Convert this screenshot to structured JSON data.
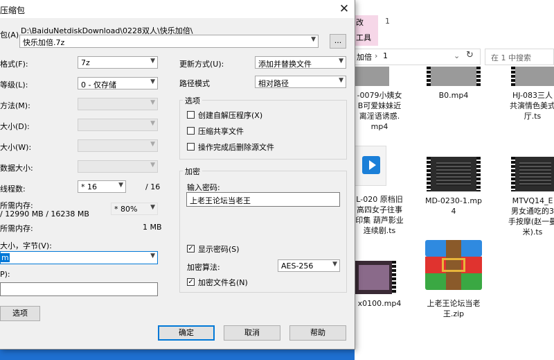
{
  "dialog": {
    "title": "压缩包",
    "close_glyph": "✕",
    "archive_label": "包(A)",
    "archive_path": "D:\\BaiduNetdiskDownload\\0228双人\\快乐加倍\\",
    "archive_name": "快乐加倍.7z",
    "browse_label": "...",
    "format": {
      "label": "格式(F):",
      "value": "7z"
    },
    "level": {
      "label": "等级(L):",
      "value": "0 - 仅存储"
    },
    "method": {
      "label": "方法(M):"
    },
    "dict": {
      "label": "大小(D):"
    },
    "word": {
      "label": "大小(W):"
    },
    "solid": {
      "label": "数据大小:"
    },
    "threads": {
      "label": "线程数:",
      "value": "* 16",
      "max": "/ 16"
    },
    "mem_compress": {
      "label": "所需内存:",
      "detail": "/ 12990 MB / 16238 MB",
      "value": "* 80%"
    },
    "mem_decompress": {
      "label": "所需内存:",
      "value": "1 MB"
    },
    "volume": {
      "label": "大小，字节(V):",
      "value": "m"
    },
    "params": {
      "label": "P):"
    },
    "options_button": "选项",
    "update_mode": {
      "label": "更新方式(U):",
      "value": "添加并替换文件"
    },
    "path_mode": {
      "label": "路径模式",
      "value": "相对路径"
    },
    "options_group": {
      "title": "选项",
      "sfx": {
        "label": "创建自解压程序(X)",
        "checked": false
      },
      "shared": {
        "label": "压缩共享文件",
        "checked": false
      },
      "delete": {
        "label": "操作完成后删除源文件",
        "checked": false
      }
    },
    "encryption": {
      "title": "加密",
      "password_label": "输入密码:",
      "password_value": "上老王论坛当老王",
      "show_password": {
        "label": "显示密码(S)",
        "checked": true
      },
      "method_label": "加密算法:",
      "method_value": "AES-256",
      "encrypt_names": {
        "label": "加密文件名(N)",
        "checked": true
      }
    },
    "ok": "确定",
    "cancel": "取消",
    "help": "帮助",
    "check_glyph": "✓"
  },
  "explorer": {
    "tab_highlight": "改",
    "tab_tools": "工具",
    "tab_number": "1",
    "address": {
      "part1": "加倍",
      "sep": "›",
      "part2": "1"
    },
    "refresh_glyph": "↻",
    "search_placeholder": "在 1 中搜索",
    "files": [
      {
        "lines": [
          "-0079小姨女",
          "B可爱妹妹近",
          "离淫语诱惑.",
          "mp4"
        ]
      },
      {
        "lines": [
          "B0.mp4"
        ]
      },
      {
        "lines": [
          "HJ-083三人",
          "共演情色美式",
          "厅.ts"
        ]
      },
      {
        "lines": [
          "L-020 原档旧",
          "高四女子往事",
          "印集 葫芦影业",
          "连续剧.ts"
        ]
      },
      {
        "lines": [
          "MD-0230-1.mp",
          "4"
        ]
      },
      {
        "lines": [
          "MTVQ14_E",
          "男女通吃的3",
          "手按摩(赵一曼",
          "米).ts"
        ]
      },
      {
        "lines": [
          "x0100.mp4"
        ]
      },
      {
        "lines": [
          "上老王论坛当老",
          "王.zip"
        ]
      }
    ]
  }
}
